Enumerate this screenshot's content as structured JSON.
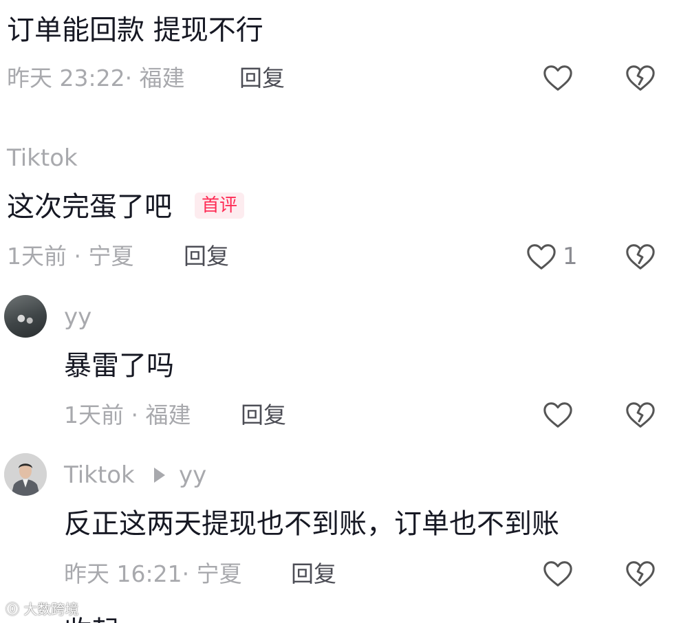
{
  "comments": [
    {
      "content": "订单能回款 提现不行",
      "time_location": "昨天 23:22· 福建",
      "reply_label": "回复"
    },
    {
      "username": "Tiktok",
      "content": "这次完蛋了吧",
      "badge": "首评",
      "time_location": "1天前 · 宁夏",
      "reply_label": "回复",
      "like_count": "1"
    },
    {
      "username": "yy",
      "content": "暴雷了吗",
      "time_location": "1天前 · 福建",
      "reply_label": "回复"
    },
    {
      "username": "Tiktok",
      "reply_to": "yy",
      "content": "反正这两天提现也不到账，订单也不到账",
      "time_location": "昨天 16:21· 宁夏",
      "reply_label": "回复"
    }
  ],
  "collapse_label": "收起",
  "watermark": "大数跨境",
  "icons": {
    "like": "heart-outline-icon",
    "dislike": "broken-heart-icon",
    "reply_arrow": "triangle-right-icon"
  },
  "colors": {
    "text_primary": "#161823",
    "text_secondary": "#a8a9ad",
    "reply": "#4c4d55",
    "badge_text": "#fe2c55",
    "badge_bg": "#fdecef",
    "icon": "#555555"
  }
}
